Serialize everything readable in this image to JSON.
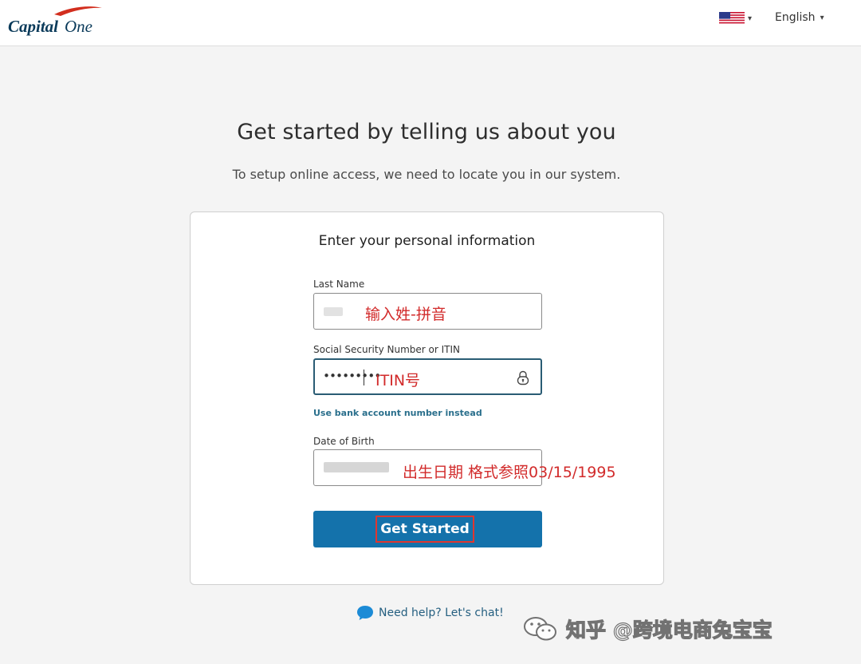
{
  "header": {
    "brand_name": "Capital One",
    "brand_word_1": "Capital",
    "brand_word_2": "One",
    "country_flag_icon": "us-flag-icon",
    "language": "English"
  },
  "page": {
    "headline": "Get started by telling us about you",
    "subline": "To setup online access, we need to locate you in our system."
  },
  "form": {
    "title": "Enter your personal information",
    "last_name": {
      "label": "Last Name",
      "annotation": "输入姓-拼音"
    },
    "ssn": {
      "label": "Social Security Number or ITIN",
      "masked_value": "•••••••••",
      "annotation": "ITIN号"
    },
    "bank_account_link": "Use bank account number instead",
    "dob": {
      "label": "Date of Birth",
      "annotation": "出生日期 格式参照03/15/1995"
    },
    "submit_label": "Get Started"
  },
  "help": {
    "text": "Need help? Let's chat!"
  },
  "watermark": {
    "text": "知乎 @跨境电商兔宝宝"
  },
  "colors": {
    "primary_button": "#1472ab",
    "link": "#2a6f8c",
    "annotation_red": "#d22b2b",
    "brand_red": "#d22e1e",
    "brand_navy": "#0a3a5a"
  }
}
